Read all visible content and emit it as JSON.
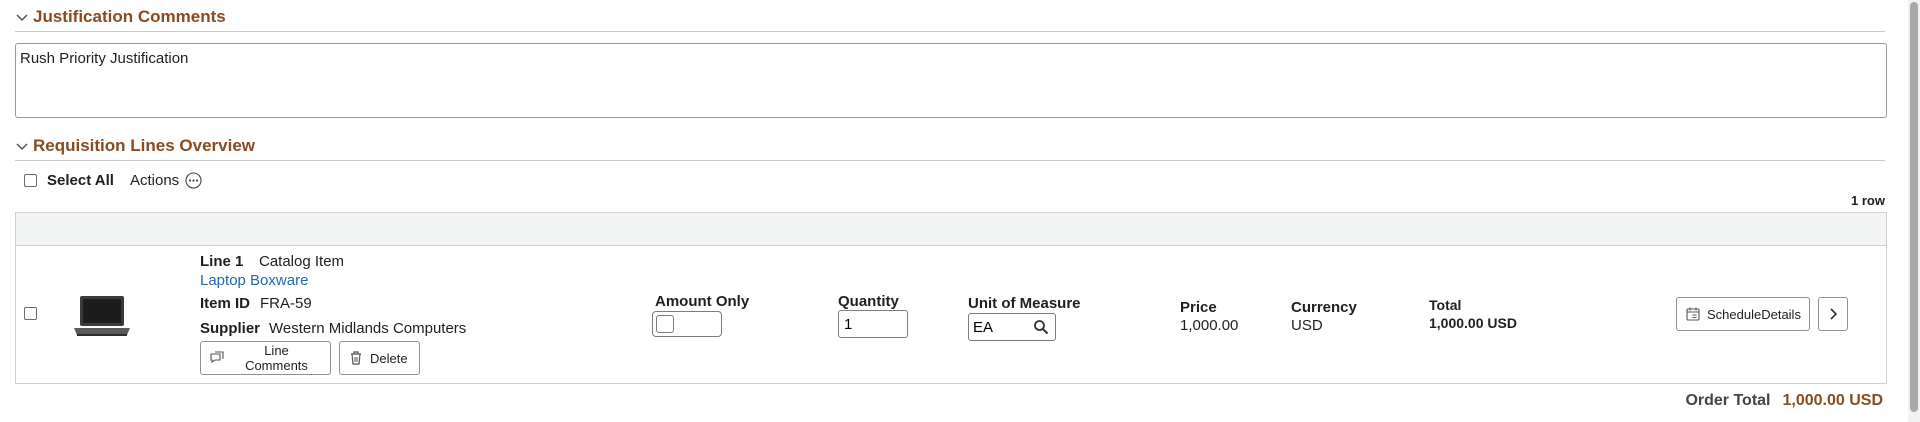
{
  "justification": {
    "title": "Justification Comments",
    "text": "Rush Priority Justification"
  },
  "lines_overview": {
    "title": "Requisition Lines Overview",
    "select_all_label": "Select All",
    "actions_label": "Actions",
    "row_count": "1 row"
  },
  "line": {
    "line_label": "Line 1",
    "type": "Catalog Item",
    "item_name": "Laptop Boxware",
    "item_id_label": "Item ID",
    "item_id": "FRA-59",
    "supplier_label": "Supplier",
    "supplier": "Western Midlands Computers",
    "line_comments_label": "Line Comments",
    "delete_label": "Delete",
    "amount_only_label": "Amount Only",
    "quantity_label": "Quantity",
    "quantity": "1",
    "uom_label": "Unit of Measure",
    "uom": "EA",
    "price_label": "Price",
    "price": "1,000.00",
    "currency_label": "Currency",
    "currency": "USD",
    "total_label": "Total",
    "total": "1,000.00 USD",
    "schedule_details_label": "ScheduleDetails"
  },
  "order_total": {
    "label": "Order Total",
    "value": "1,000.00 USD"
  },
  "colors": {
    "section_title": "#8a4a22",
    "link": "#2367b6"
  }
}
